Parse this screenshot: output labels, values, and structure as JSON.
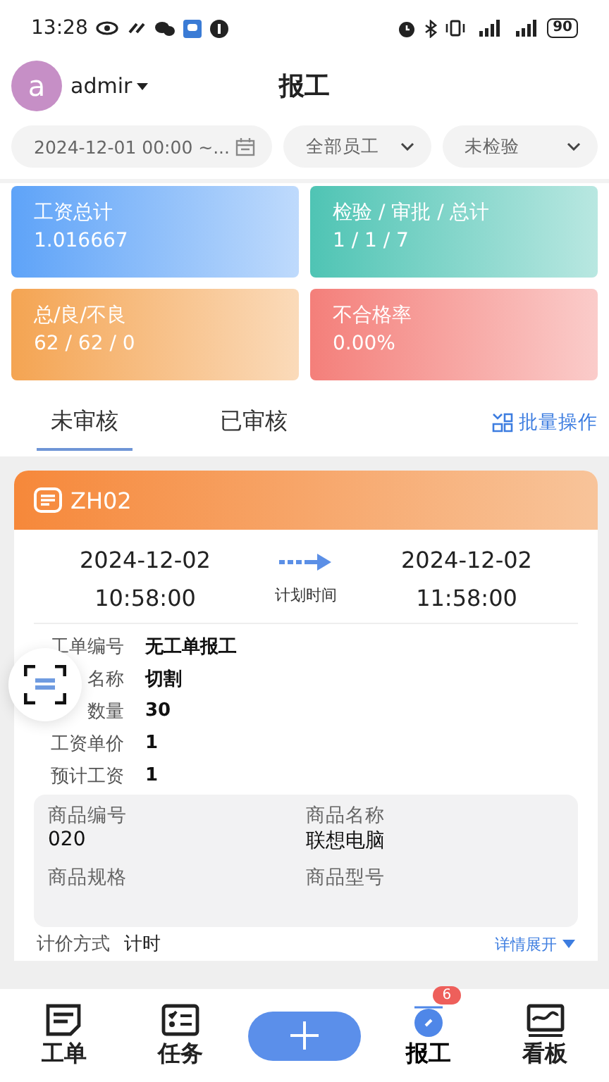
{
  "status_bar": {
    "time": "13:28",
    "battery": "90"
  },
  "header": {
    "avatar_letter": "a",
    "user": "admir",
    "title": "报工"
  },
  "filters": [
    {
      "kind": "date",
      "value": "2024-12-01 00:00 ~..."
    },
    {
      "kind": "select",
      "value": "全部员工"
    },
    {
      "kind": "select",
      "value": "未检验"
    }
  ],
  "stats": [
    {
      "label": "工资总计",
      "value": "1.016667",
      "color": "#5ea3f8"
    },
    {
      "label": "检验 / 审批 / 总计",
      "value": "1 / 1 / 7",
      "color": "#4fc4b4"
    },
    {
      "label": "总/良/不良",
      "value": "62 / 62 / 0",
      "color": "#f4a452"
    },
    {
      "label": "不合格率",
      "value": "0.00%",
      "color": "#f47f7a"
    }
  ],
  "tabs": [
    {
      "label": "未审核",
      "selected": true
    },
    {
      "label": "已审核",
      "selected": false
    }
  ],
  "batch_action": "批量操作",
  "record": {
    "code": "ZH02",
    "start_date": "2024-12-02",
    "start_time": "10:58:00",
    "plan_label": "计划时间",
    "end_date": "2024-12-02",
    "end_time": "11:58:00",
    "fields": [
      {
        "label": "工单编号",
        "value": "无工单报工"
      },
      {
        "label": "名称",
        "value": "切割"
      },
      {
        "label": "数量",
        "value": "30"
      },
      {
        "label": "工资单价",
        "value": "1"
      },
      {
        "label": "预计工资",
        "value": "1"
      }
    ],
    "product": [
      {
        "label": "商品编号",
        "value": "020"
      },
      {
        "label": "商品名称",
        "value": "联想电脑"
      },
      {
        "label": "商品规格"
      },
      {
        "label": "商品型号"
      }
    ],
    "pricing": {
      "label": "计价方式",
      "value": "计时"
    },
    "expand": "详情展开"
  },
  "nav": [
    {
      "kind": "order",
      "label": "工单",
      "selected": false
    },
    {
      "kind": "task",
      "label": "任务",
      "selected": false
    },
    {
      "kind": "add"
    },
    {
      "kind": "report",
      "label": "报工",
      "selected": true,
      "badge": "6"
    },
    {
      "kind": "board",
      "label": "看板",
      "selected": false
    }
  ]
}
